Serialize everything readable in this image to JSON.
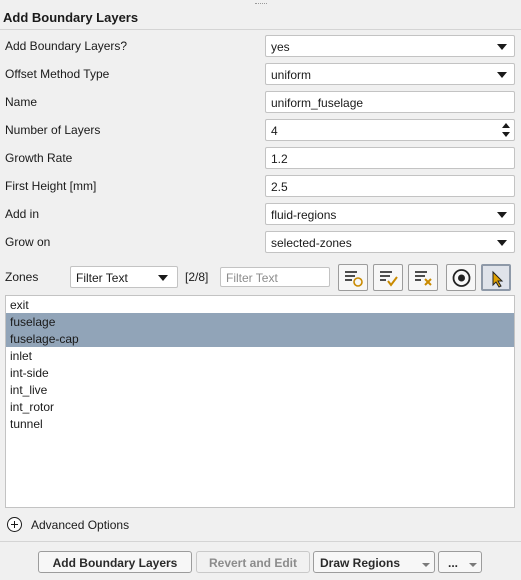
{
  "panel": {
    "title": "Add Boundary Layers"
  },
  "fields": [
    {
      "label": "Add Boundary Layers?",
      "value": "yes",
      "kind": "dropdown"
    },
    {
      "label": "Offset Method Type",
      "value": "uniform",
      "kind": "dropdown"
    },
    {
      "label": "Name",
      "value": "uniform_fuselage",
      "kind": "text"
    },
    {
      "label": "Number of Layers",
      "value": "4",
      "kind": "spinner"
    },
    {
      "label": "Growth Rate",
      "value": "1.2",
      "kind": "text"
    },
    {
      "label": "First Height [mm]",
      "value": "2.5",
      "kind": "text"
    },
    {
      "label": "Add in",
      "value": "fluid-regions",
      "kind": "dropdown"
    },
    {
      "label": "Grow on",
      "value": "selected-zones",
      "kind": "dropdown"
    }
  ],
  "zones": {
    "label": "Zones",
    "filter_mode": "Filter Text",
    "count": "[2/8]",
    "filter_placeholder": "Filter Text",
    "toolbar_icons": [
      "select-all-icon",
      "select-checked-icon",
      "deselect-icon",
      "target-icon",
      "pointer-select-icon"
    ],
    "items": [
      {
        "name": "exit",
        "selected": false
      },
      {
        "name": "fuselage",
        "selected": true
      },
      {
        "name": "fuselage-cap",
        "selected": true
      },
      {
        "name": "inlet",
        "selected": false
      },
      {
        "name": "int-side",
        "selected": false
      },
      {
        "name": "int_live",
        "selected": false
      },
      {
        "name": "int_rotor",
        "selected": false
      },
      {
        "name": "tunnel",
        "selected": false
      }
    ]
  },
  "advanced": {
    "label": "Advanced Options"
  },
  "buttons": {
    "add": "Add Boundary Layers",
    "revert": "Revert and Edit",
    "draw": "Draw Regions",
    "more": "..."
  },
  "colors": {
    "selection": "#91a4b8",
    "background": "#f0f0f0"
  }
}
